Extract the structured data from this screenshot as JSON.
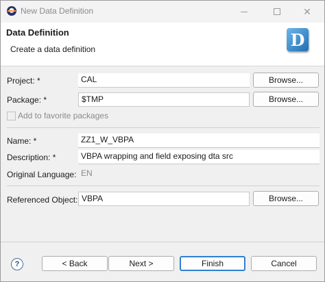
{
  "window": {
    "title": "New Data Definition"
  },
  "header": {
    "title": "Data Definition",
    "message": "Create a data definition",
    "icon_letter": "D"
  },
  "form": {
    "project_label": "Project: *",
    "project_value": "CAL",
    "package_label": "Package: *",
    "package_value": "$TMP",
    "browse_label": "Browse...",
    "favorite_label": "Add to favorite packages",
    "name_label": "Name: *",
    "name_value": "ZZ1_W_VBPA",
    "description_label": "Description: *",
    "description_value": "VBPA wrapping and field exposing dta src",
    "original_language_label": "Original Language:",
    "original_language_value": "EN",
    "referenced_object_label": "Referenced Object:",
    "referenced_object_value": "VBPA"
  },
  "footer": {
    "help": "?",
    "back": "< Back",
    "next": "Next >",
    "finish": "Finish",
    "cancel": "Cancel"
  },
  "icons": {
    "app": "eclipse-icon",
    "minimize": "minimize-icon",
    "maximize": "maximize-icon",
    "close": "close-icon",
    "help": "help-icon",
    "header": "data-definition-icon"
  }
}
